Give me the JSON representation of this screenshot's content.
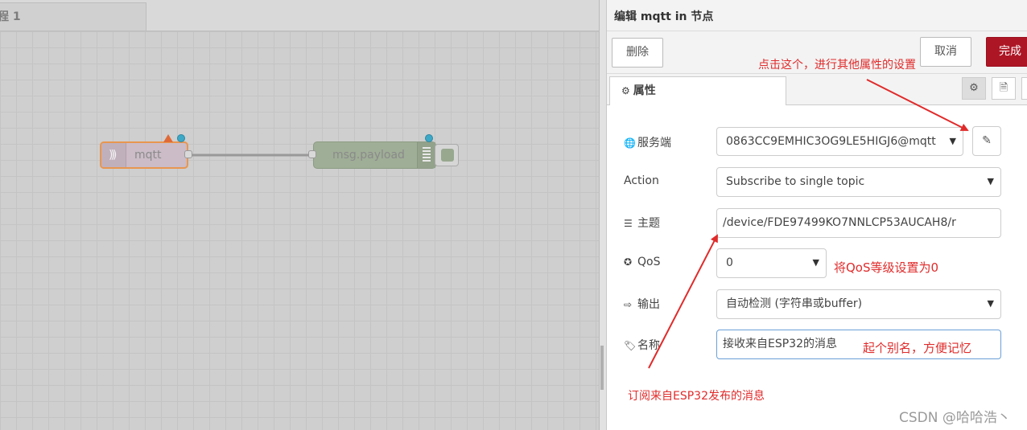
{
  "workspace": {
    "flow_tab_label": "程 1",
    "nodes": {
      "mqtt_label": "mqtt",
      "debug_label": "msg.payload"
    }
  },
  "panel": {
    "title": "编辑 mqtt in 节点",
    "buttons": {
      "delete": "删除",
      "cancel": "取消",
      "done": "完成"
    },
    "tab_properties": "属性",
    "fields": {
      "server": {
        "label": "服务端",
        "value": "0863CC9EMHIC3OG9LE5HIGJ6@mqtt"
      },
      "action": {
        "label": "Action",
        "value": "Subscribe to single topic"
      },
      "topic": {
        "label": "主题",
        "value": "/device/FDE97499KO7NNLCP53AUCAH8/r"
      },
      "qos": {
        "label": "QoS",
        "value": "0"
      },
      "output": {
        "label": "输出",
        "value": "自动检测 (字符串或buffer)"
      },
      "name": {
        "label": "名称",
        "value": "接收来自ESP32的消息"
      }
    }
  },
  "annotations": {
    "edit_hint": "点击这个，进行其他属性的设置",
    "qos_hint": "将QoS等级设置为0",
    "name_hint": "起个别名，方便记忆",
    "topic_hint": "订阅来自ESP32发布的消息"
  },
  "watermark": "CSDN @哈哈浩丶",
  "colors": {
    "annotation_red": "#e02b2b",
    "done_button": "#ad1625",
    "mqtt_node": "#cbbcc7",
    "debug_node": "#9fae96"
  }
}
